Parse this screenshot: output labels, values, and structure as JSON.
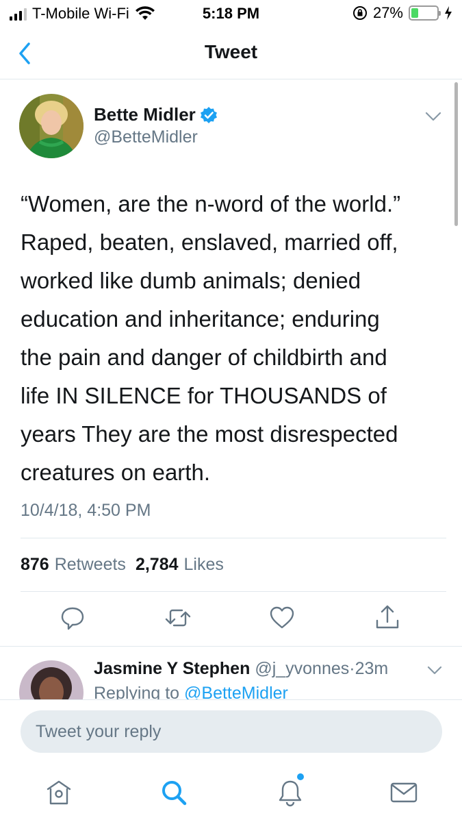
{
  "status_bar": {
    "carrier": "T-Mobile Wi-Fi",
    "time": "5:18 PM",
    "battery_percent": "27%",
    "battery_level": 0.27,
    "icons": [
      "signal-icon",
      "wifi-icon",
      "orientation-lock-icon",
      "battery-icon",
      "charging-icon"
    ]
  },
  "nav": {
    "title": "Tweet",
    "back_icon": "chevron-left-icon"
  },
  "tweet": {
    "author_name": "Bette Midler",
    "verified": true,
    "handle": "@BetteMidler",
    "text_lines": [
      "“Women, are the n-word of the world.”",
      "Raped, beaten,  enslaved, married off,",
      "worked like dumb animals; denied",
      "education and inheritance; enduring",
      "the pain and danger of childbirth and",
      "life IN SILENCE for THOUSANDS of",
      "years They are the most disrespected",
      "creatures on earth."
    ],
    "timestamp": "10/4/18, 4:50 PM",
    "retweet_count": "876",
    "retweet_label": "Retweets",
    "like_count": "2,784",
    "like_label": "Likes",
    "actions": [
      "reply-icon",
      "retweet-icon",
      "like-icon",
      "share-icon"
    ]
  },
  "reply": {
    "name": "Jasmine Y Stephen",
    "handle": "@j_yvonnes",
    "separator": "·",
    "time": "23m",
    "replying_prefix": "Replying to",
    "replying_to": "@BetteMidler"
  },
  "compose": {
    "placeholder": "Tweet your reply"
  },
  "tabbar": {
    "tabs": [
      "home-icon",
      "search-icon",
      "notifications-icon",
      "messages-icon"
    ],
    "active": "search-icon"
  },
  "colors": {
    "accent": "#1da1f2",
    "secondary_text": "#657786",
    "divider": "#e1e8ed",
    "battery": "#4cd964"
  }
}
